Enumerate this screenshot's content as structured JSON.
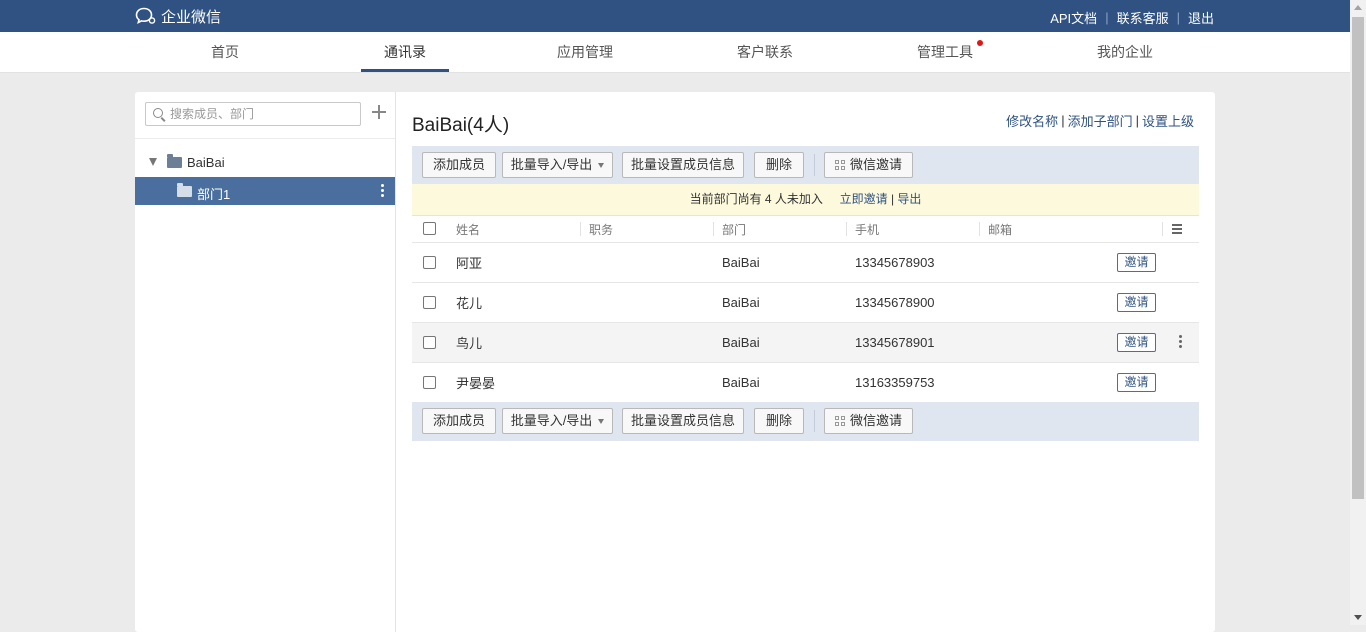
{
  "app": {
    "logo_text": "企业微信",
    "top_links": [
      "API文档",
      "联系客服",
      "退出"
    ]
  },
  "nav": {
    "items": [
      {
        "label": "首页"
      },
      {
        "label": "通讯录",
        "active": true
      },
      {
        "label": "应用管理"
      },
      {
        "label": "客户联系"
      },
      {
        "label": "管理工具",
        "badge": true
      },
      {
        "label": "我的企业"
      }
    ]
  },
  "sidebar": {
    "search_placeholder": "搜索成员、部门",
    "tree": {
      "root": "BaiBai",
      "children": [
        "部门1"
      ]
    }
  },
  "dept": {
    "title": "BaiBai(4人)",
    "actions": [
      "修改名称",
      "添加子部门",
      "设置上级"
    ]
  },
  "toolbar": {
    "add_member": "添加成员",
    "batch_import_export": "批量导入/导出",
    "batch_set": "批量设置成员信息",
    "delete": "删除",
    "wechat_invite": "微信邀请"
  },
  "notice": {
    "text": "当前部门尚有 4 人未加入",
    "invite_now": "立即邀请",
    "sep": "|",
    "export": "导出"
  },
  "table": {
    "headers": [
      "姓名",
      "职务",
      "部门",
      "手机",
      "邮箱"
    ],
    "invite_label": "邀请",
    "rows": [
      {
        "name": "阿亚",
        "title": "",
        "dept": "BaiBai",
        "phone": "13345678903",
        "email": ""
      },
      {
        "name": "花儿",
        "title": "",
        "dept": "BaiBai",
        "phone": "13345678900",
        "email": ""
      },
      {
        "name": "鸟儿",
        "title": "",
        "dept": "BaiBai",
        "phone": "13345678901",
        "email": ""
      },
      {
        "name": "尹晏晏",
        "title": "",
        "dept": "BaiBai",
        "phone": "13163359753",
        "email": ""
      }
    ]
  },
  "colors": {
    "header_bg": "#2f5283",
    "selected_tree_bg": "#4a6f9e",
    "toolbar_bg": "#dfe6f0",
    "notice_bg": "#fdf9dc",
    "nav_badge": "#e21616"
  }
}
